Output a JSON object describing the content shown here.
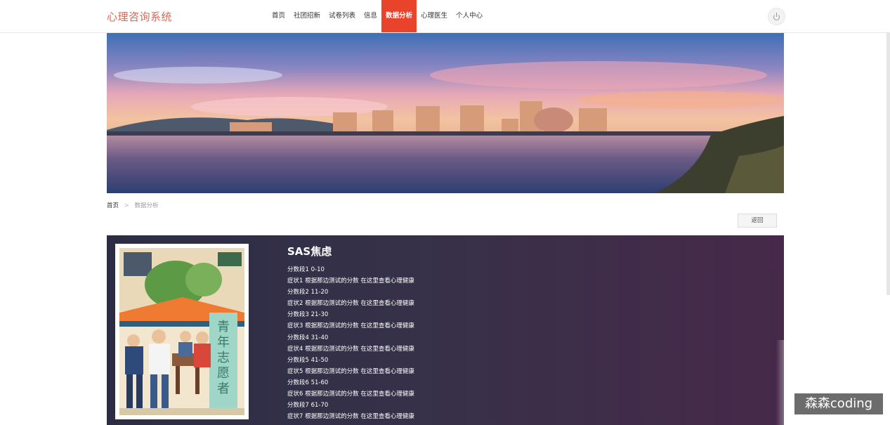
{
  "header": {
    "brand": "心理咨询系统",
    "menu": [
      {
        "label": "首页",
        "active": false
      },
      {
        "label": "社团招新",
        "active": false
      },
      {
        "label": "试卷列表",
        "active": false
      },
      {
        "label": "信息",
        "active": false
      },
      {
        "label": "数据分析",
        "active": true
      },
      {
        "label": "心理医生",
        "active": false
      },
      {
        "label": "个人中心",
        "active": false
      }
    ],
    "accent_color": "#e9432c",
    "brand_color": "#d96a55"
  },
  "breadcrumb": {
    "home": "首页",
    "separator": ">",
    "current": "数据分析"
  },
  "back_button": "返回",
  "article": {
    "title": "SAS焦虑",
    "lines": [
      "分数段1   0-10",
      "症状1   根据那边测试的分数 在这里查看心理健康",
      "分数段2   11-20",
      "症状2   根据那边测试的分数 在这里查看心理健康",
      "分数段3   21-30",
      "症状3   根据那边测试的分数 在这里查看心理健康",
      "分数段4   31-40",
      "症状4   根据那边测试的分数 在这里查看心理健康",
      "分数段5   41-50",
      "症状5   根据那边测试的分数 在这里查看心理健康",
      "分数段6   51-60",
      "症状6   根据那边测试的分数 在这里查看心理健康",
      "分数段7   61-70",
      "症状7   根据那边测试的分数 在这里查看心理健康"
    ],
    "illustration_text": "青年志愿者"
  },
  "watermark": "森森coding"
}
